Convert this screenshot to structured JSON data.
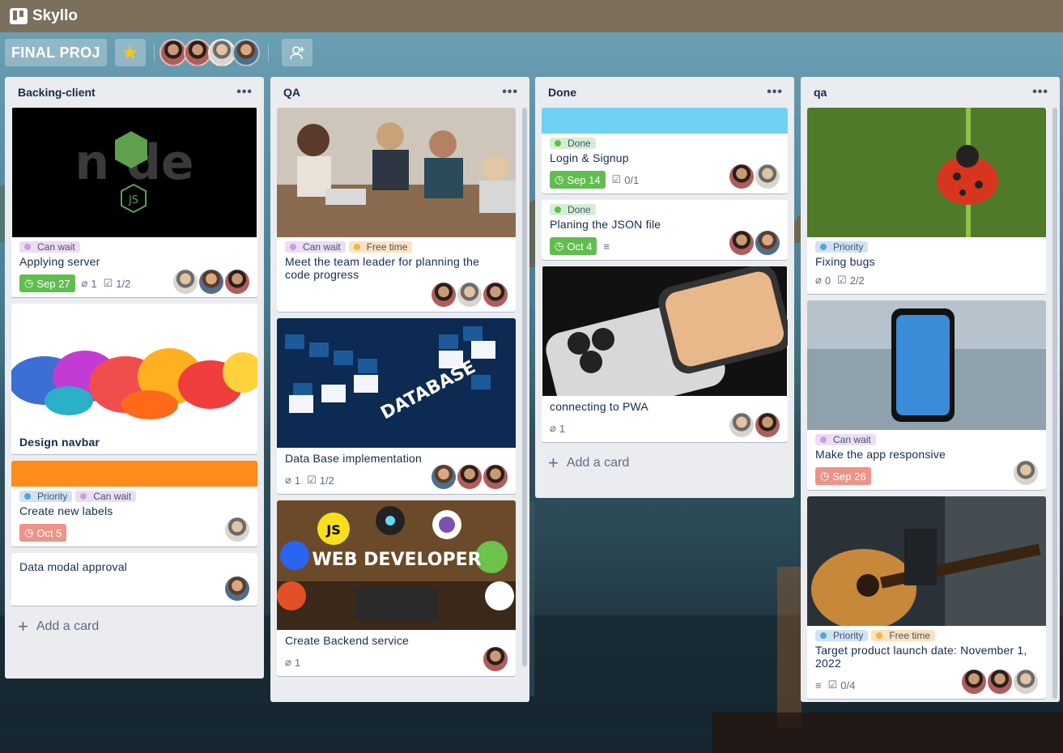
{
  "app": {
    "name": "Skyllo"
  },
  "board": {
    "title": "FINAL PROJ",
    "starred_icon": "star-icon",
    "invite_icon": "add-member-icon"
  },
  "colors": {
    "topbar": "#7c6f5c",
    "list_bg": "#ebecf0",
    "due_green": "#61bd4f",
    "due_red": "#ec9488",
    "cover_blue": "#6fd2f5",
    "cover_orange": "#ff8c1a"
  },
  "lists": [
    {
      "title": "Backing-client",
      "add_label": "Add a card",
      "cards": [
        {
          "cover": "node-js-logo",
          "labels": [
            "Can wait"
          ],
          "title": "Applying server",
          "due": "Sep 27",
          "attachments": "1",
          "checklist": "1/2"
        },
        {
          "cover": "colorful-paint-splash",
          "title": "Design navbar"
        },
        {
          "cover": "orange",
          "labels": [
            "Priority",
            "Can wait"
          ],
          "title": "Create new labels",
          "due": "Oct 5"
        },
        {
          "title": "Data modal approval"
        }
      ]
    },
    {
      "title": "QA",
      "cards": [
        {
          "cover": "team-meeting-photo",
          "labels": [
            "Can wait",
            "Free time"
          ],
          "title": "Meet the team leader for planning the code progress"
        },
        {
          "cover": "database-keyboard",
          "cover_text": "DATABASE",
          "title": "Data Base implementation",
          "attachments": "1",
          "checklist": "1/2"
        },
        {
          "cover": "web-developer-illustration",
          "cover_text": "WEB DEVELOPER",
          "title": "Create Backend service",
          "attachments": "1"
        }
      ]
    },
    {
      "title": "Done",
      "add_label": "Add a card",
      "cards": [
        {
          "cover": "blue",
          "labels": [
            "Done"
          ],
          "title": "Login & Signup",
          "due": "Sep 14",
          "checklist": "0/1"
        },
        {
          "labels": [
            "Done"
          ],
          "title": "Planing the JSON file",
          "due": "Oct 4"
        },
        {
          "cover": "iphone-photo",
          "title": "connecting to PWA",
          "attachments": "1"
        }
      ]
    },
    {
      "title": "qa",
      "cards": [
        {
          "cover": "ladybug-photo",
          "labels": [
            "Priority"
          ],
          "title": "Fixing bugs",
          "attachments": "0",
          "checklist": "2/2"
        },
        {
          "cover": "phone-lake-photo",
          "labels": [
            "Can wait"
          ],
          "title": "Make the app responsive",
          "due": "Sep 26"
        },
        {
          "cover": "guitar-photo",
          "labels": [
            "Priority",
            "Free time"
          ],
          "title": "Target product launch date: November 1, 2022",
          "checklist": "0/4"
        }
      ]
    }
  ]
}
